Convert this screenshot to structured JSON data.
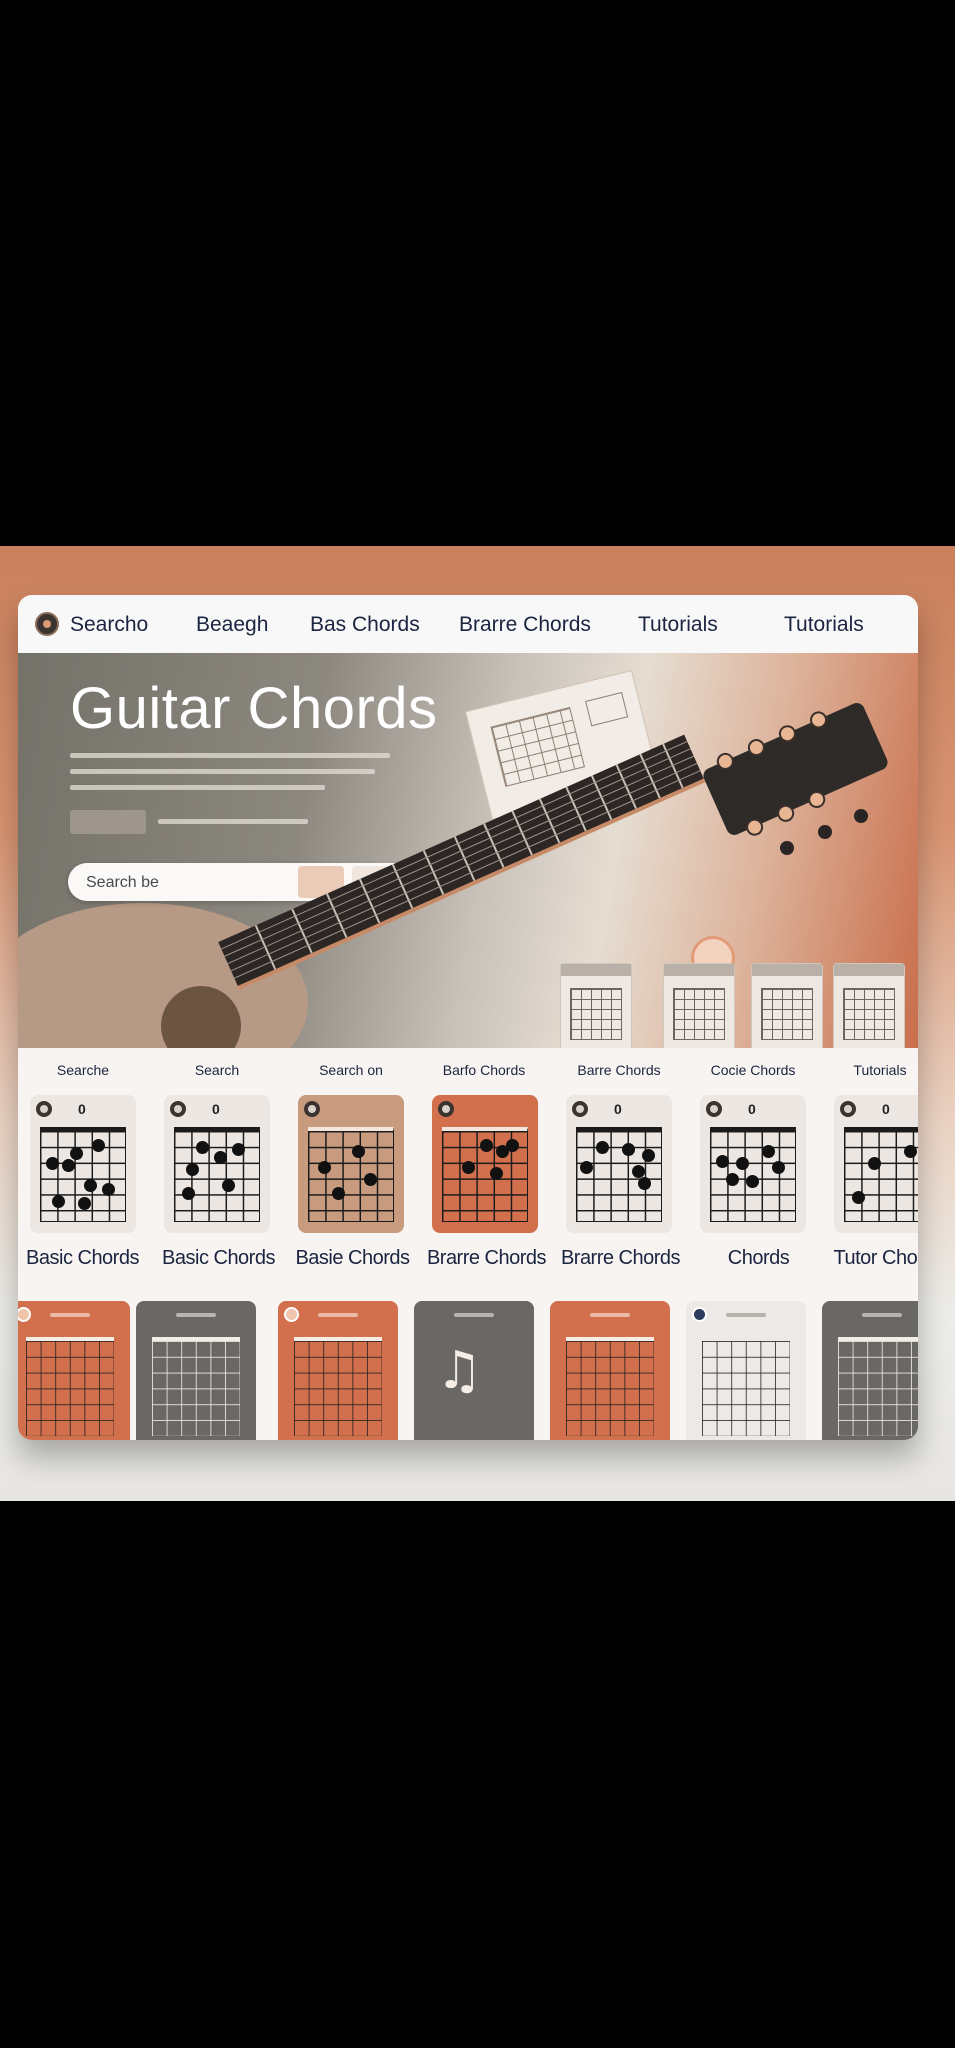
{
  "nav": {
    "items": [
      {
        "label": "Searcho"
      },
      {
        "label": "Beaegh"
      },
      {
        "label": "Bas Chords"
      },
      {
        "label": "Brarre Chords"
      },
      {
        "label": "Tutorials"
      },
      {
        "label": "Tutorials"
      }
    ]
  },
  "hero": {
    "title": "Guitar Chords",
    "search_placeholder": "Search be"
  },
  "section_labels": [
    "Searche",
    "Search",
    "Search on",
    "Barfo Chords",
    "Barre Chords",
    "Cocie Chords",
    "Tutorials"
  ],
  "chord_cards": [
    {
      "fret_marker": "0",
      "color": "#ece7e2"
    },
    {
      "fret_marker": "0",
      "color": "#ece7e2"
    },
    {
      "fret_marker": "",
      "color": "#c89b7e"
    },
    {
      "fret_marker": "",
      "color": "#d2704e"
    },
    {
      "fret_marker": "0",
      "color": "#ece7e2"
    },
    {
      "fret_marker": "0",
      "color": "#ece7e2"
    },
    {
      "fret_marker": "0",
      "color": "#ece7e2"
    }
  ],
  "card_labels": [
    "Basic Chords",
    "Basic Chords",
    "Basie Chords",
    "Brarre Chords",
    "Brarre Chords",
    "Chords",
    "Tutor Chords"
  ],
  "colors": {
    "accent": "#d2704e",
    "nav_text": "#1b2440",
    "hero_gray": "#7e7b74"
  }
}
